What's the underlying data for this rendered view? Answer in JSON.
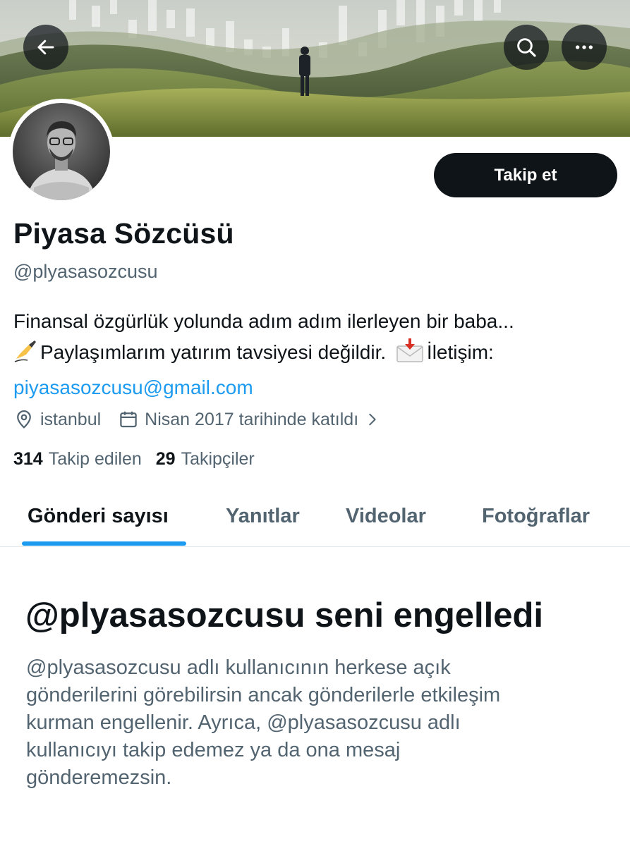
{
  "header": {
    "back_icon": "arrow-left-icon",
    "search_icon": "search-icon",
    "more_icon": "more-horizontal-icon"
  },
  "profile": {
    "display_name": "Piyasa Sözcüsü",
    "handle": "@plyasasozcusu",
    "follow_label": "Takip et",
    "bio": {
      "line1": "Finansal özgürlük yolunda adım adım ilerleyen bir baba...",
      "line2_prefix_emoji": "writing-hand-emoji",
      "line2_text": "Paylaşımlarım yatırım tavsiyesi değildir.",
      "line2_mail_emoji": "envelope-with-arrow-emoji",
      "line2_suffix": "İletişim:",
      "email": "piyasasozcusu@gmail.com"
    },
    "location": "istanbul",
    "joined": "Nisan 2017 tarihinde katıldı",
    "following_count": "314",
    "following_label": "Takip edilen",
    "followers_count": "29",
    "followers_label": "Takipçiler"
  },
  "tabs": [
    {
      "label": "Gönderi sayısı",
      "active": true
    },
    {
      "label": "Yanıtlar",
      "active": false
    },
    {
      "label": "Videolar",
      "active": false
    },
    {
      "label": "Fotoğraflar",
      "active": false
    }
  ],
  "blocked": {
    "title": "@plyasasozcusu seni engelledi",
    "lines": [
      "@plyasasozcusu adlı kullanıcının herkese açık",
      "gönderilerini görebilirsin ancak gönderilerle etkileşim",
      "kurman engellenir. Ayrıca, @plyasasozcusu adlı",
      "kullanıcıyı takip edemez ya da ona mesaj",
      "gönderemezsin."
    ]
  },
  "colors": {
    "accent": "#1d9bf0",
    "text_primary": "#0f1419",
    "text_secondary": "#536471",
    "button_dark": "#0f1419"
  }
}
